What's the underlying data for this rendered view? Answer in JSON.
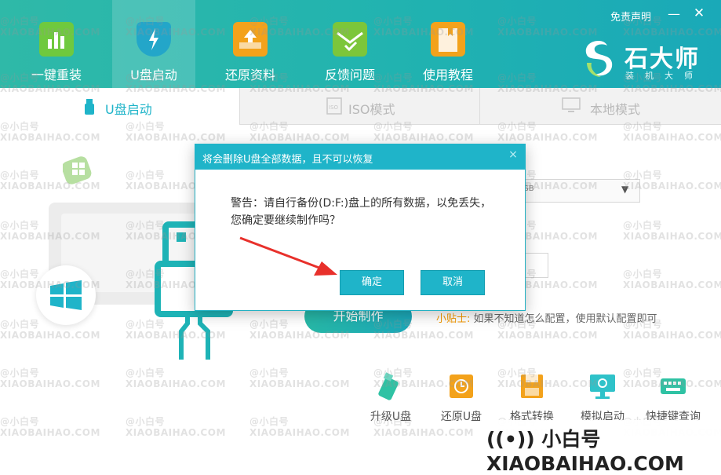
{
  "header": {
    "nav": [
      {
        "label": "一键重装",
        "icon": "chart-bars-icon"
      },
      {
        "label": "U盘启动",
        "icon": "usb-shield-icon"
      },
      {
        "label": "还原资料",
        "icon": "restore-upload-icon"
      },
      {
        "label": "反馈问题",
        "icon": "mail-check-icon"
      },
      {
        "label": "使用教程",
        "icon": "book-icon"
      }
    ],
    "disclaimer": "免责声明",
    "minimize": "—",
    "close": "✕",
    "brand_name": "石大师",
    "brand_sub": "装机大师"
  },
  "tabs": [
    {
      "label": "U盘启动",
      "icon": "usb-drive-icon"
    },
    {
      "label": "ISO模式",
      "icon": "iso-file-icon"
    },
    {
      "label": "本地模式",
      "icon": "monitor-icon"
    }
  ],
  "form": {
    "select_value": "GB",
    "start_button": "开始制作",
    "tip_label": "小贴士:",
    "tip_text": " 如果不知道怎么配置，使用默认配置即可"
  },
  "tools": [
    {
      "label": "升级U盘",
      "icon": "usb-upgrade-icon"
    },
    {
      "label": "还原U盘",
      "icon": "usb-restore-icon"
    },
    {
      "label": "格式转换",
      "icon": "floppy-icon"
    },
    {
      "label": "模拟启动",
      "icon": "simulate-monitor-icon"
    },
    {
      "label": "快捷键查询",
      "icon": "keyboard-icon"
    }
  ],
  "modal": {
    "title": "将会删除U盘全部数据，且不可以恢复",
    "close": "×",
    "message_line1": "警告：请自行备份(D:F:)盘上的所有数据，以免丢失，",
    "message_line2": "您确定要继续制作吗？",
    "ok": "确定",
    "cancel": "取消"
  },
  "watermark": {
    "brand": "((•)) 小白号 XIAOBAIHAO.COM",
    "tile_line1": "@小白号",
    "tile_line2": "XIAOBAIHAO.COM"
  },
  "colors": {
    "header_start": "#2fb9a8",
    "header_end": "#1aa9b8",
    "accent": "#1fb4c9",
    "tip": "#f39800"
  }
}
